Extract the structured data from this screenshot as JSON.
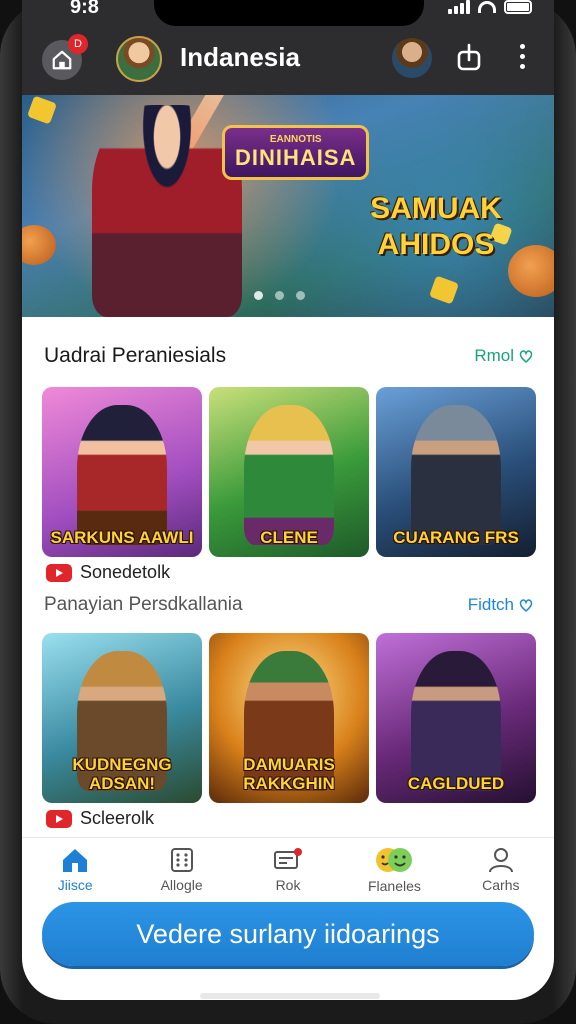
{
  "status_bar": {
    "time": "9:8"
  },
  "header": {
    "title": "Indanesia",
    "notification_count": "D"
  },
  "banner": {
    "logo_small": "EANNOTIS",
    "logo_big": "DINIHAISA",
    "headline_line1": "SAMUAK",
    "headline_line2": "AHIDOS",
    "slides": 3,
    "active_slide": 0
  },
  "section1": {
    "title": "Uadrai Peraniesials",
    "link": "Rmol",
    "cards": [
      {
        "label": "SARKUNS AAWLI",
        "bg": "#d66cc8"
      },
      {
        "label": "CLENE",
        "bg": "#3a8a3a"
      },
      {
        "label": "CUARANG FRS",
        "bg": "#2a4f7a"
      }
    ],
    "channel": "Sonedetolk"
  },
  "section2": {
    "title": "Panayian Persdkallania",
    "link": "Fidtch",
    "cards": [
      {
        "label": "KUDNEGNG ADSAN!",
        "bg": "#3a8aa0"
      },
      {
        "label": "DAMUARIS RAKKGHIN",
        "bg": "#b86a1a"
      },
      {
        "label": "CAGLDUED",
        "bg": "#6a2a7a"
      }
    ],
    "channel": "Scleerolk"
  },
  "bottom_nav": [
    {
      "label": "Jiisce",
      "icon": "home-icon",
      "active": true
    },
    {
      "label": "Allogle",
      "icon": "grid-icon",
      "active": false
    },
    {
      "label": "Rok",
      "icon": "store-icon",
      "active": false
    },
    {
      "label": "Flaneles",
      "icon": "friends-icon",
      "active": false
    },
    {
      "label": "Carhs",
      "icon": "profile-icon",
      "active": false
    }
  ],
  "cta": {
    "label": "Vedere surlany iidoarings"
  },
  "colors": {
    "accent": "#1e7fd6",
    "link_green": "#1aa37a",
    "badge_red": "#e0262a"
  }
}
